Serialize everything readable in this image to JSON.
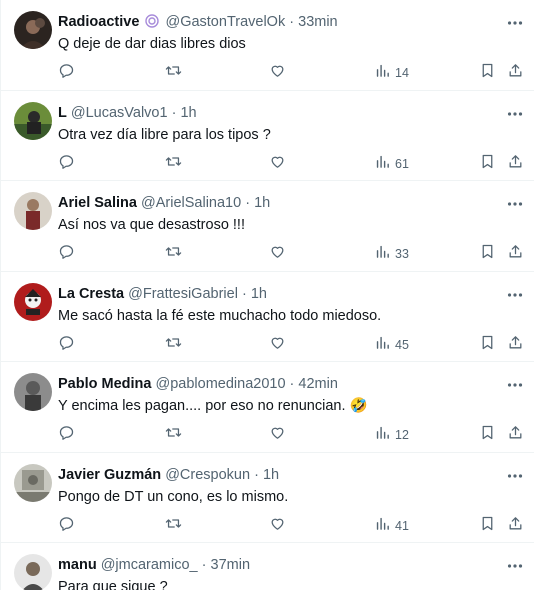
{
  "tweets": [
    {
      "name": "Radioactive",
      "handle": "@GastonTravelOk",
      "time": "33min",
      "text": "Q deje de dar dias libres dios",
      "views": "14",
      "avatar": "avatar-radioactive"
    },
    {
      "name": "L",
      "handle": "@LucasValvo1",
      "time": "1h",
      "text": "Otra vez día libre para los tipos ?",
      "views": "61",
      "avatar": "avatar-l"
    },
    {
      "name": "Ariel Salina",
      "handle": "@ArielSalina10",
      "time": "1h",
      "text": "Así nos va que desastroso !!!",
      "views": "33",
      "avatar": "avatar-ariel"
    },
    {
      "name": "La Cresta",
      "handle": "@FrattesiGabriel",
      "time": "1h",
      "text": "Me sacó hasta la fé este muchacho todo miedoso.",
      "views": "45",
      "avatar": "avatar-lacresta"
    },
    {
      "name": "Pablo Medina",
      "handle": "@pablomedina2010",
      "time": "42min",
      "text": "Y encima les pagan.... por eso no renuncian. 🤣",
      "views": "12",
      "avatar": "avatar-pablo"
    },
    {
      "name": "Javier Guzmán",
      "handle": "@Crespokun",
      "time": "1h",
      "text": "Pongo de DT un cono, es lo mismo.",
      "views": "41",
      "avatar": "avatar-javier"
    },
    {
      "name": "manu",
      "handle": "@jmcaramico_",
      "time": "37min",
      "text": "Para que sigue ?",
      "views": "",
      "avatar": "avatar-manu"
    }
  ],
  "separator": "·",
  "colors": {
    "text": "#0f1419",
    "secondary": "#536471",
    "border": "#eff3f4",
    "badge": "#a78bda"
  },
  "icons": [
    "reply-icon",
    "retweet-icon",
    "like-icon",
    "views-icon",
    "bookmark-icon",
    "share-icon",
    "more-icon"
  ]
}
